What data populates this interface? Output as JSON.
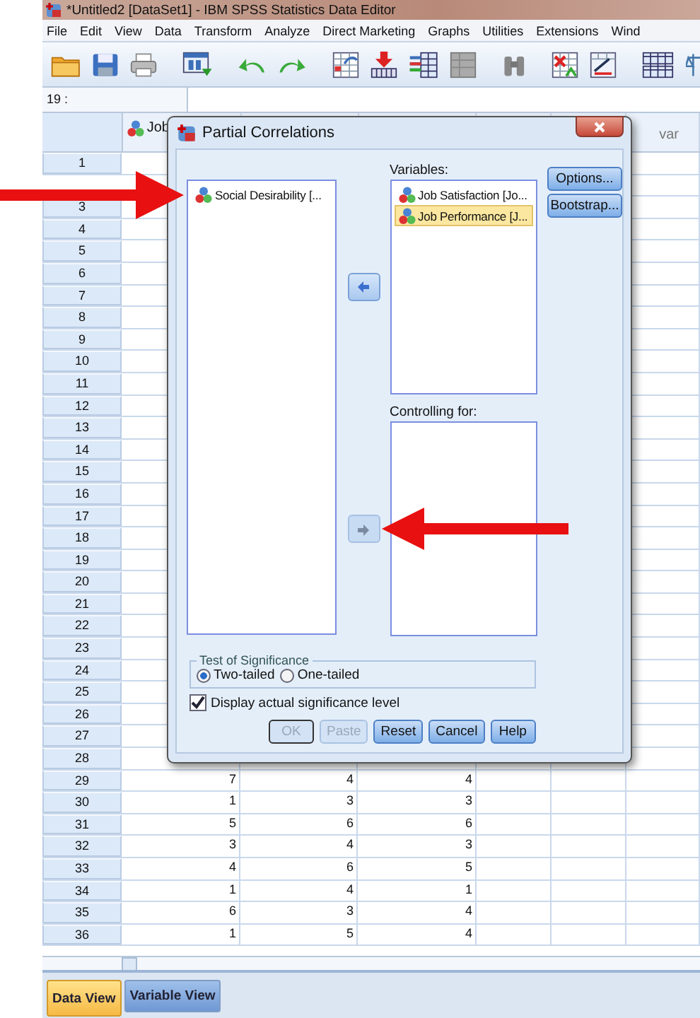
{
  "window": {
    "title": "*Untitled2 [DataSet1] - IBM SPSS Statistics Data Editor"
  },
  "menu": [
    "File",
    "Edit",
    "View",
    "Data",
    "Transform",
    "Analyze",
    "Direct Marketing",
    "Graphs",
    "Utilities",
    "Extensions",
    "Wind"
  ],
  "cell_ref": "19 :",
  "columns": [
    {
      "kind": "variable",
      "label": "Job"
    },
    {
      "kind": "blank"
    },
    {
      "kind": "blank"
    },
    {
      "kind": "blank"
    },
    {
      "kind": "blank"
    },
    {
      "kind": "var",
      "label": "var"
    }
  ],
  "rows": [
    {
      "label": "1"
    },
    {
      "kind": "covered"
    },
    {
      "label": "3"
    },
    {
      "label": "4"
    },
    {
      "label": "5"
    },
    {
      "label": "6"
    },
    {
      "label": "7"
    },
    {
      "label": "8"
    },
    {
      "label": "9"
    },
    {
      "label": "10"
    },
    {
      "label": "11"
    },
    {
      "label": "12"
    },
    {
      "label": "13"
    },
    {
      "label": "14"
    },
    {
      "label": "15"
    },
    {
      "label": "16"
    },
    {
      "label": "17"
    },
    {
      "label": "18"
    },
    {
      "label": "19"
    },
    {
      "label": "20"
    },
    {
      "label": "21"
    },
    {
      "label": "22"
    },
    {
      "label": "23"
    },
    {
      "label": "24"
    },
    {
      "label": "25"
    },
    {
      "label": "26"
    },
    {
      "label": "27"
    },
    {
      "label": "28"
    },
    {
      "label": "29",
      "cells": [
        "7",
        "4",
        "4"
      ]
    },
    {
      "label": "30",
      "cells": [
        "1",
        "3",
        "3"
      ]
    },
    {
      "label": "31",
      "cells": [
        "5",
        "6",
        "6"
      ]
    },
    {
      "label": "32",
      "cells": [
        "3",
        "4",
        "3"
      ]
    },
    {
      "label": "33",
      "cells": [
        "4",
        "6",
        "5"
      ]
    },
    {
      "label": "34",
      "cells": [
        "1",
        "4",
        "1"
      ]
    },
    {
      "label": "35",
      "cells": [
        "6",
        "3",
        "4"
      ]
    },
    {
      "label": "36",
      "cells": [
        "1",
        "5",
        "4"
      ]
    }
  ],
  "tabs": [
    {
      "label": "Data View",
      "selected": true
    },
    {
      "label": "Variable View",
      "selected": false
    }
  ],
  "dialog": {
    "title": "Partial Correlations",
    "source_items": [
      {
        "label": "Social Desirability [...",
        "selected": false
      }
    ],
    "variables_label": "Variables:",
    "variables": [
      {
        "label": "Job Satisfaction [Jo...",
        "selected": false
      },
      {
        "label": "Job Performance [J...",
        "selected": true
      }
    ],
    "controlling_label": "Controlling for:",
    "move_buttons": [
      {
        "disabled": false
      },
      {
        "disabled": true
      }
    ],
    "side_buttons": [
      "Options...",
      "Bootstrap..."
    ],
    "significance": {
      "title": "Test of Significance",
      "options": [
        {
          "label": "Two-tailed",
          "selected": true
        },
        {
          "label": "One-tailed",
          "selected": false
        }
      ]
    },
    "display_level": {
      "label": "Display actual significance level",
      "checked": true
    },
    "buttons": [
      {
        "label": "OK",
        "disabled": true
      },
      {
        "label": "Paste",
        "disabled": true
      },
      {
        "label": "Reset",
        "disabled": false
      },
      {
        "label": "Cancel",
        "disabled": false
      },
      {
        "label": "Help",
        "disabled": false
      }
    ]
  }
}
